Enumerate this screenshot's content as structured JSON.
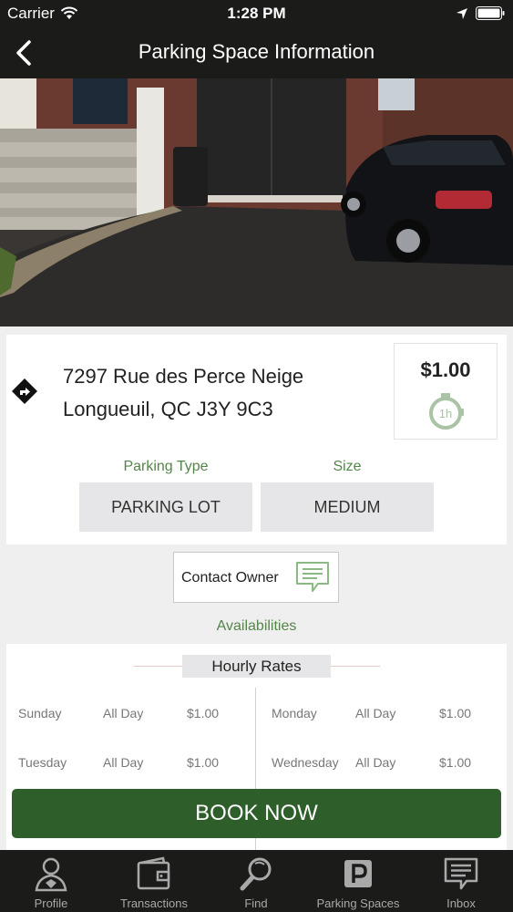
{
  "status_bar": {
    "carrier": "Carrier",
    "time": "1:28 PM"
  },
  "nav": {
    "title": "Parking Space Information"
  },
  "listing": {
    "address_line1": "7297 Rue des Perce Neige",
    "address_line2": "Longueuil, QC  J3Y 9C3",
    "price": "$1.00",
    "duration_badge": "1h",
    "parking_type_label": "Parking Type",
    "parking_type_value": "PARKING LOT",
    "size_label": "Size",
    "size_value": "MEDIUM"
  },
  "contact": {
    "label": "Contact Owner"
  },
  "availabilities": {
    "label": "Availabilities",
    "header": "Hourly Rates",
    "rows": [
      {
        "day": "Sunday",
        "time": "All Day",
        "price": "$1.00"
      },
      {
        "day": "Monday",
        "time": "All Day",
        "price": "$1.00"
      },
      {
        "day": "Tuesday",
        "time": "All Day",
        "price": "$1.00"
      },
      {
        "day": "Wednesday",
        "time": "All Day",
        "price": "$1.00"
      }
    ]
  },
  "book_button": {
    "label": "BOOK NOW"
  },
  "tabs": [
    {
      "label": "Profile",
      "icon": "profile-icon"
    },
    {
      "label": "Transactions",
      "icon": "wallet-icon"
    },
    {
      "label": "Find",
      "icon": "magnifier-icon"
    },
    {
      "label": "Parking Spaces",
      "icon": "parking-p-icon"
    },
    {
      "label": "Inbox",
      "icon": "chat-icon"
    }
  ],
  "colors": {
    "bar_background": "#1b1c1a",
    "accent_green": "#2e5e2a",
    "label_green": "#54854a",
    "page_background": "#efefef"
  }
}
